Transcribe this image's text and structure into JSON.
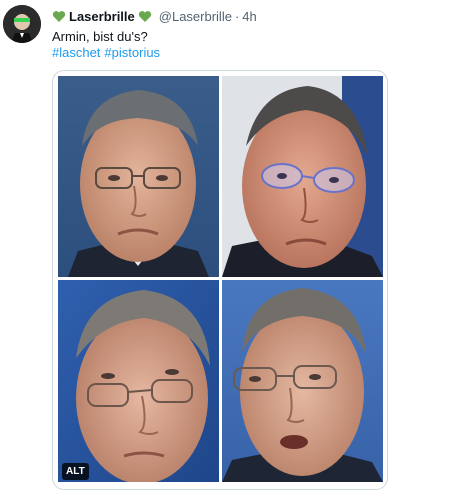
{
  "tweet": {
    "display_name": "Laserbrille",
    "handle": "@Laserbrille",
    "separator": "·",
    "time": "4h",
    "text": "Armin, bist du's?",
    "hashtags": [
      "#laschet",
      "#pistorius"
    ],
    "heart_icon_color": "#6aa84f",
    "link_color": "#1d9bf0"
  },
  "media": {
    "photo_count": 4,
    "alt_label": "ALT"
  }
}
